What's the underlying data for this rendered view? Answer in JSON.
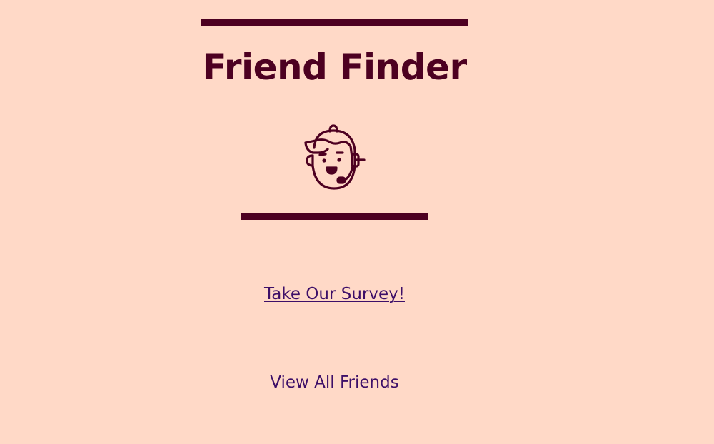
{
  "page": {
    "title": "Friend Finder",
    "avatar_icon": "headset-person-icon"
  },
  "links": {
    "survey_label": "Take Our Survey!",
    "friends_label": "View All Friends"
  },
  "colors": {
    "background": "#ffd9c7",
    "accent": "#4d0021",
    "link": "#3d0f68"
  }
}
